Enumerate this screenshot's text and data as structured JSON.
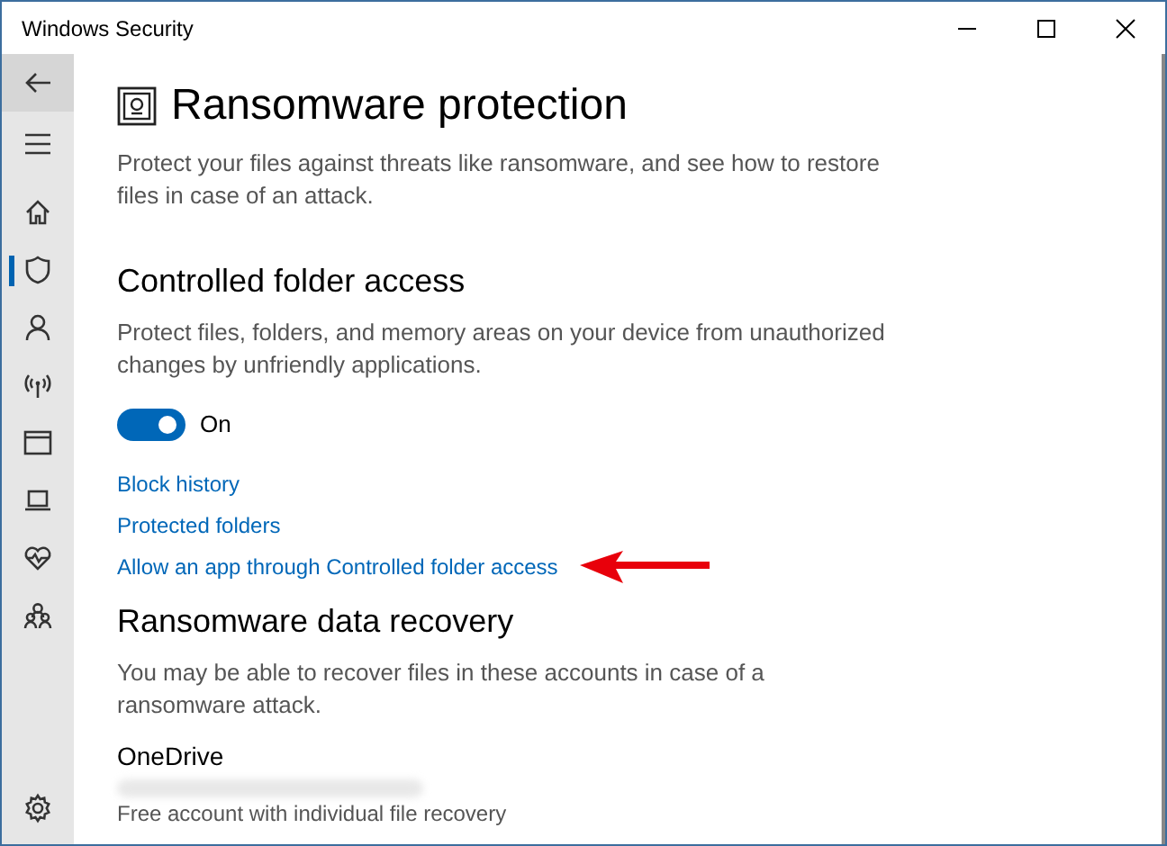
{
  "window": {
    "title": "Windows Security",
    "controls": [
      {
        "kind": "minimize"
      },
      {
        "kind": "maximize"
      },
      {
        "kind": "close"
      }
    ]
  },
  "sidebar": {
    "items": [
      {
        "kind": "menu",
        "selected": false
      },
      {
        "kind": "home",
        "selected": false
      },
      {
        "kind": "shield",
        "selected": true
      },
      {
        "kind": "person",
        "selected": false
      },
      {
        "kind": "wireless",
        "selected": false
      },
      {
        "kind": "browser",
        "selected": false
      },
      {
        "kind": "laptop",
        "selected": false
      },
      {
        "kind": "heart",
        "selected": false
      },
      {
        "kind": "family",
        "selected": false
      }
    ],
    "footer": {
      "kind": "gear",
      "selected": false
    }
  },
  "page": {
    "title": "Ransomware protection",
    "description": "Protect your files against threats like ransomware, and see how to restore files in case of an attack."
  },
  "controlled_folder_access": {
    "heading": "Controlled folder access",
    "description": "Protect files, folders, and memory areas on your device from unauthorized changes by unfriendly applications.",
    "toggle": {
      "on": true,
      "label": "On"
    },
    "links": [
      "Block history",
      "Protected folders",
      "Allow an app through Controlled folder access"
    ]
  },
  "data_recovery": {
    "heading": "Ransomware data recovery",
    "description": "You may be able to recover files in these accounts in case of a ransomware attack.",
    "account": {
      "name": "OneDrive",
      "details": "Free account with individual file recovery"
    }
  }
}
